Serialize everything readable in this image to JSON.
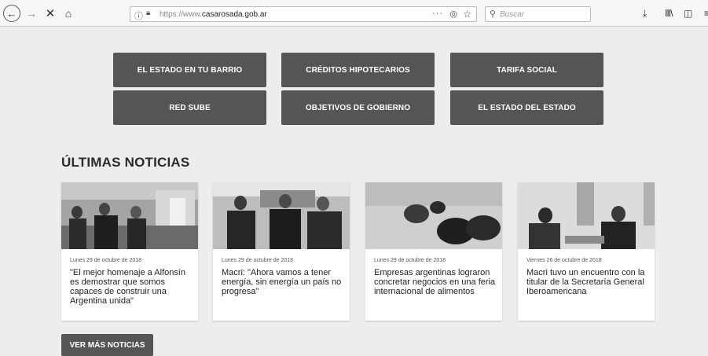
{
  "browser": {
    "url_prefix": "https://www.",
    "url_domain": "casarosada.gob.ar",
    "search_placeholder": "Buscar"
  },
  "quick_links": [
    "EL ESTADO EN TU BARRIO",
    "CRÉDITOS HIPOTECARIOS",
    "TARIFA SOCIAL",
    "RED SUBE",
    "OBJETIVOS DE GOBIERNO",
    "EL ESTADO DEL ESTADO"
  ],
  "news": {
    "title": "ÚLTIMAS NOTICIAS",
    "items": [
      {
        "date": "Lunes 29 de octubre de 2018",
        "title": "\"El mejor homenaje a Alfonsín es demostrar que somos capaces de construir una Argentina unida\""
      },
      {
        "date": "Lunes 29 de octubre de 2018",
        "title": "Macri: \"Ahora vamos a tener energía, sin energía un país no progresa\""
      },
      {
        "date": "Lunes 29 de octubre de 2018",
        "title": "Empresas argentinas lograron concretar negocios en una feria internacional de alimentos"
      },
      {
        "date": "Viernes 26 de octubre de 2018",
        "title": "Macri tuvo un encuentro con la titular de la Secretaría General Iberoamericana"
      }
    ],
    "more_label": "VER MÁS NOTICIAS"
  }
}
